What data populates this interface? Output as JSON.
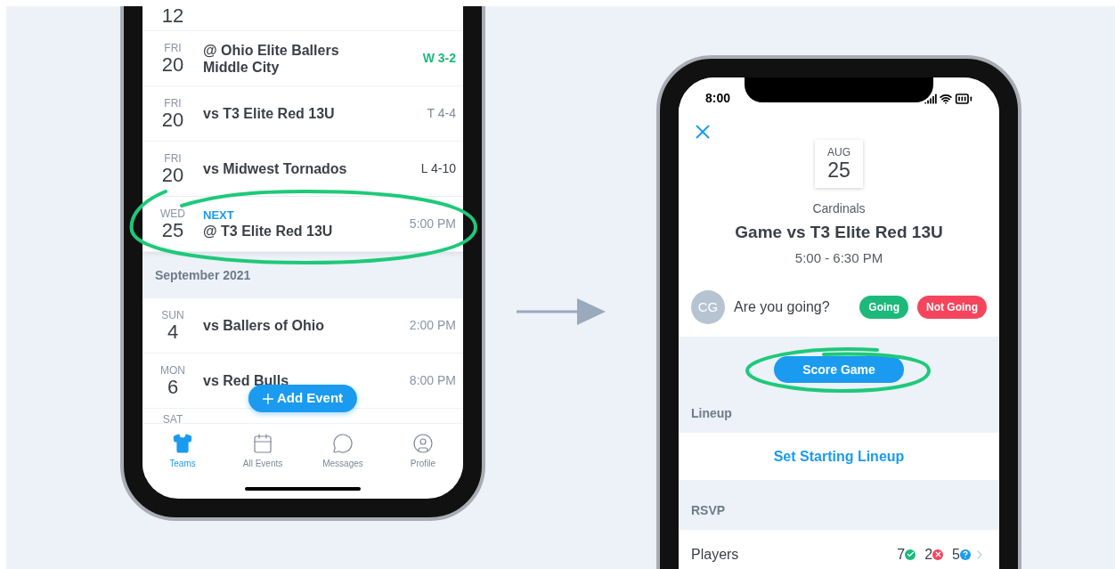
{
  "schedule_screen": {
    "events": [
      {
        "day": "12",
        "circled": false
      },
      {
        "weekday": "FRI",
        "day": "20",
        "title": "@ Ohio Elite Ballers Middle City",
        "result": {
          "text": "W 3-2",
          "kind": "win"
        },
        "circled": false
      },
      {
        "weekday": "FRI",
        "day": "20",
        "title": "vs T3 Elite Red 13U",
        "result": {
          "text": "T 4-4",
          "kind": "tie"
        },
        "circled": false
      },
      {
        "weekday": "FRI",
        "day": "20",
        "title": "vs Midwest Tornados",
        "result": {
          "text": "L 4-10",
          "kind": "loss"
        },
        "circled": false
      },
      {
        "weekday": "WED",
        "day": "25",
        "title": "@ T3 Elite Red 13U",
        "result": {
          "text": "5:00 PM",
          "kind": "time"
        },
        "next_label": "NEXT",
        "circled": true
      },
      {
        "kind": "header",
        "text": "September 2021"
      },
      {
        "weekday": "SUN",
        "day": "4",
        "title": "vs Ballers of Ohio",
        "result": {
          "text": "2:00 PM",
          "kind": "time"
        },
        "circled": false
      },
      {
        "weekday": "MON",
        "day": "6",
        "title": "vs Red Bulls",
        "result": {
          "text": "8:00 PM",
          "kind": "time"
        },
        "circled": false
      },
      {
        "weekday": "SAT",
        "circled": false
      }
    ],
    "add_button": "Add Event",
    "tabs": [
      {
        "label": "Teams",
        "selected": true
      },
      {
        "label": "All Events",
        "selected": false
      },
      {
        "label": "Messages",
        "selected": false
      },
      {
        "label": "Profile",
        "selected": false
      }
    ]
  },
  "event_screen": {
    "status_time": "8:00",
    "month": "AUG",
    "day": "25",
    "team": "Cardinals",
    "title": "Game vs T3 Elite Red 13U",
    "time": "5:00 - 6:30 PM",
    "avatar": "CG",
    "prompt": "Are you going?",
    "rsvp_buttons": [
      {
        "label": "Going",
        "kind": "going"
      },
      {
        "label": "Not Going",
        "kind": "not_going"
      }
    ],
    "score_button": {
      "label": "Score Game",
      "circled": true
    },
    "sections": [
      {
        "label": "Lineup",
        "kind": "action",
        "action": "Set Starting Lineup"
      },
      {
        "label": "RSVP",
        "kind": "counts",
        "row_label": "Players",
        "counts": [
          {
            "value": "7",
            "kind": "yes"
          },
          {
            "value": "2",
            "kind": "no"
          },
          {
            "value": "5",
            "kind": "maybe"
          }
        ]
      }
    ]
  }
}
